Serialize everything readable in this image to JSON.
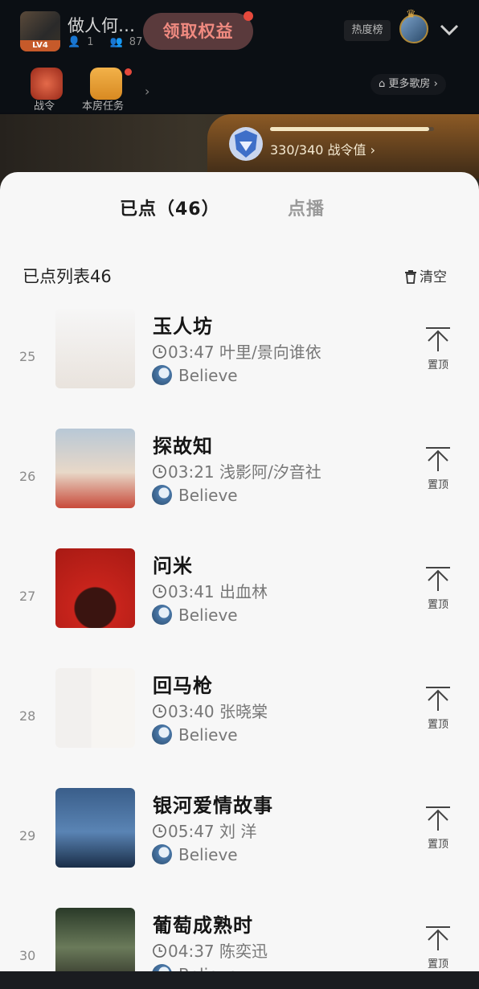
{
  "header": {
    "room_level": "LV4",
    "room_title": "做人何…",
    "stat_online": "1",
    "stat_fans": "87",
    "rights_button": "领取权益",
    "hot_rank": "热度榜",
    "sub_items": [
      {
        "label": "战令"
      },
      {
        "label": "本房任务"
      }
    ],
    "more_rooms": "更多歌房"
  },
  "battle_pass": {
    "progress_text": "330/340 战令值",
    "current": 330,
    "max": 340
  },
  "tabs": [
    {
      "label": "已点（46）",
      "active": true
    },
    {
      "label": "点播",
      "active": false
    }
  ],
  "list": {
    "title": "已点列表46",
    "clear_label": "清空",
    "pin_label": "置顶",
    "songs": [
      {
        "index": "25",
        "name": "玉人坊",
        "duration": "03:47",
        "artist": "叶里/景向谁依",
        "requester": "Believe"
      },
      {
        "index": "26",
        "name": "探故知",
        "duration": "03:21",
        "artist": "浅影阿/汐音社",
        "requester": "Believe"
      },
      {
        "index": "27",
        "name": "问米",
        "duration": "03:41",
        "artist": "出血林",
        "requester": "Believe"
      },
      {
        "index": "28",
        "name": "回马枪",
        "duration": "03:40",
        "artist": "张晓棠",
        "requester": "Believe"
      },
      {
        "index": "29",
        "name": "银河爱情故事",
        "duration": "05:47",
        "artist": "刘 洋",
        "requester": "Believe"
      },
      {
        "index": "30",
        "name": "葡萄成熟时",
        "duration": "04:37",
        "artist": "陈奕迅",
        "requester": "Believe"
      }
    ]
  },
  "colors": {
    "accent_rights": "#f08a80",
    "battle_gold": "#8c5a25",
    "sheet_bg": "#f7f7f7"
  }
}
